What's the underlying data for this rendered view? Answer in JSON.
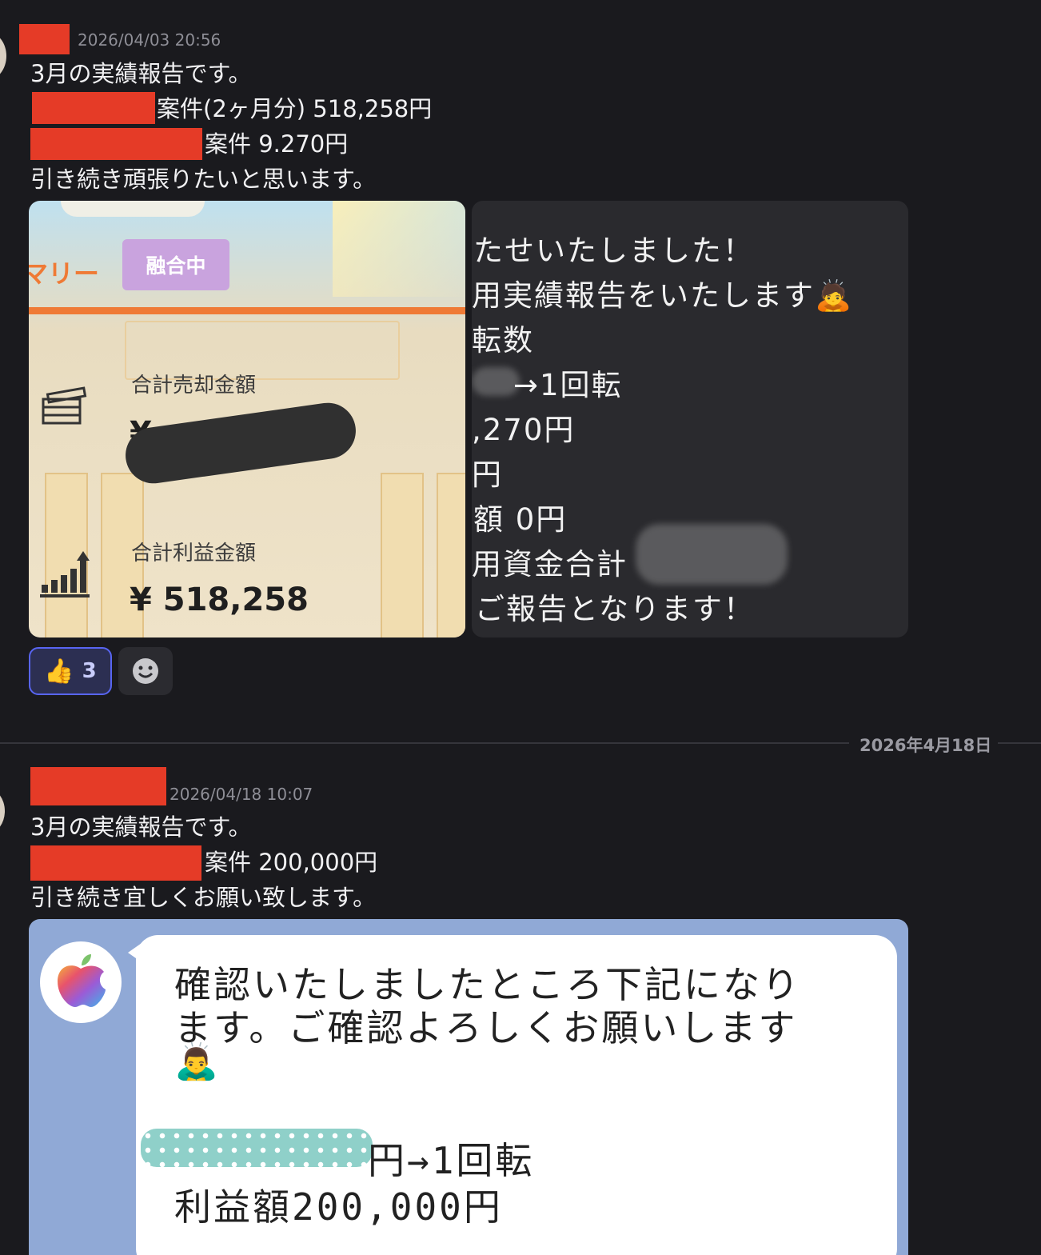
{
  "message1": {
    "timestamp": "2026/04/03 20:56",
    "lines": {
      "l1": "3月の実績報告です。",
      "l2": "案件(2ヶ月分) 518,258円",
      "l3": "案件 9.270円",
      "l4": "引き続き頑張りたいと思います。"
    },
    "image_left": {
      "banner_suffix": "マリー",
      "tag": "融合中",
      "total_sales_label": "合計売却金額",
      "total_sales_value_prefix": "¥",
      "total_profit_label": "合計利益金額",
      "total_profit_value": "¥ 518,258"
    },
    "image_right": {
      "r1": "たせいたしました！",
      "r2": "用実績報告をいたします🙇",
      "r3": "転数",
      "r4": "→1回転",
      "r5": ",270円",
      "r6": "円",
      "r7": "額 0円",
      "r8": "用資金合計",
      "r9": "ご報告となります！"
    },
    "reactions": {
      "thumbs": "👍",
      "count": "3"
    }
  },
  "divider": {
    "date": "2026年4月18日"
  },
  "message2": {
    "timestamp": "2026/04/18 10:07",
    "lines": {
      "l1": "3月の実績報告です。",
      "l2": "案件 200,000円",
      "l3": "引き続き宜しくお願い致します。"
    },
    "image": {
      "b1": "確認いたしましたところ下記になり",
      "b2": "ます。ご確認よろしくお願いします",
      "b3": "🙇‍♂️",
      "b4": "円→1回転",
      "b5": "利益額200,000円"
    }
  },
  "colors": {
    "background": "#1a1a1e",
    "redaction": "#e53b27",
    "reaction_border": "#5865f2",
    "bubble_bg": "#90a9d6"
  }
}
